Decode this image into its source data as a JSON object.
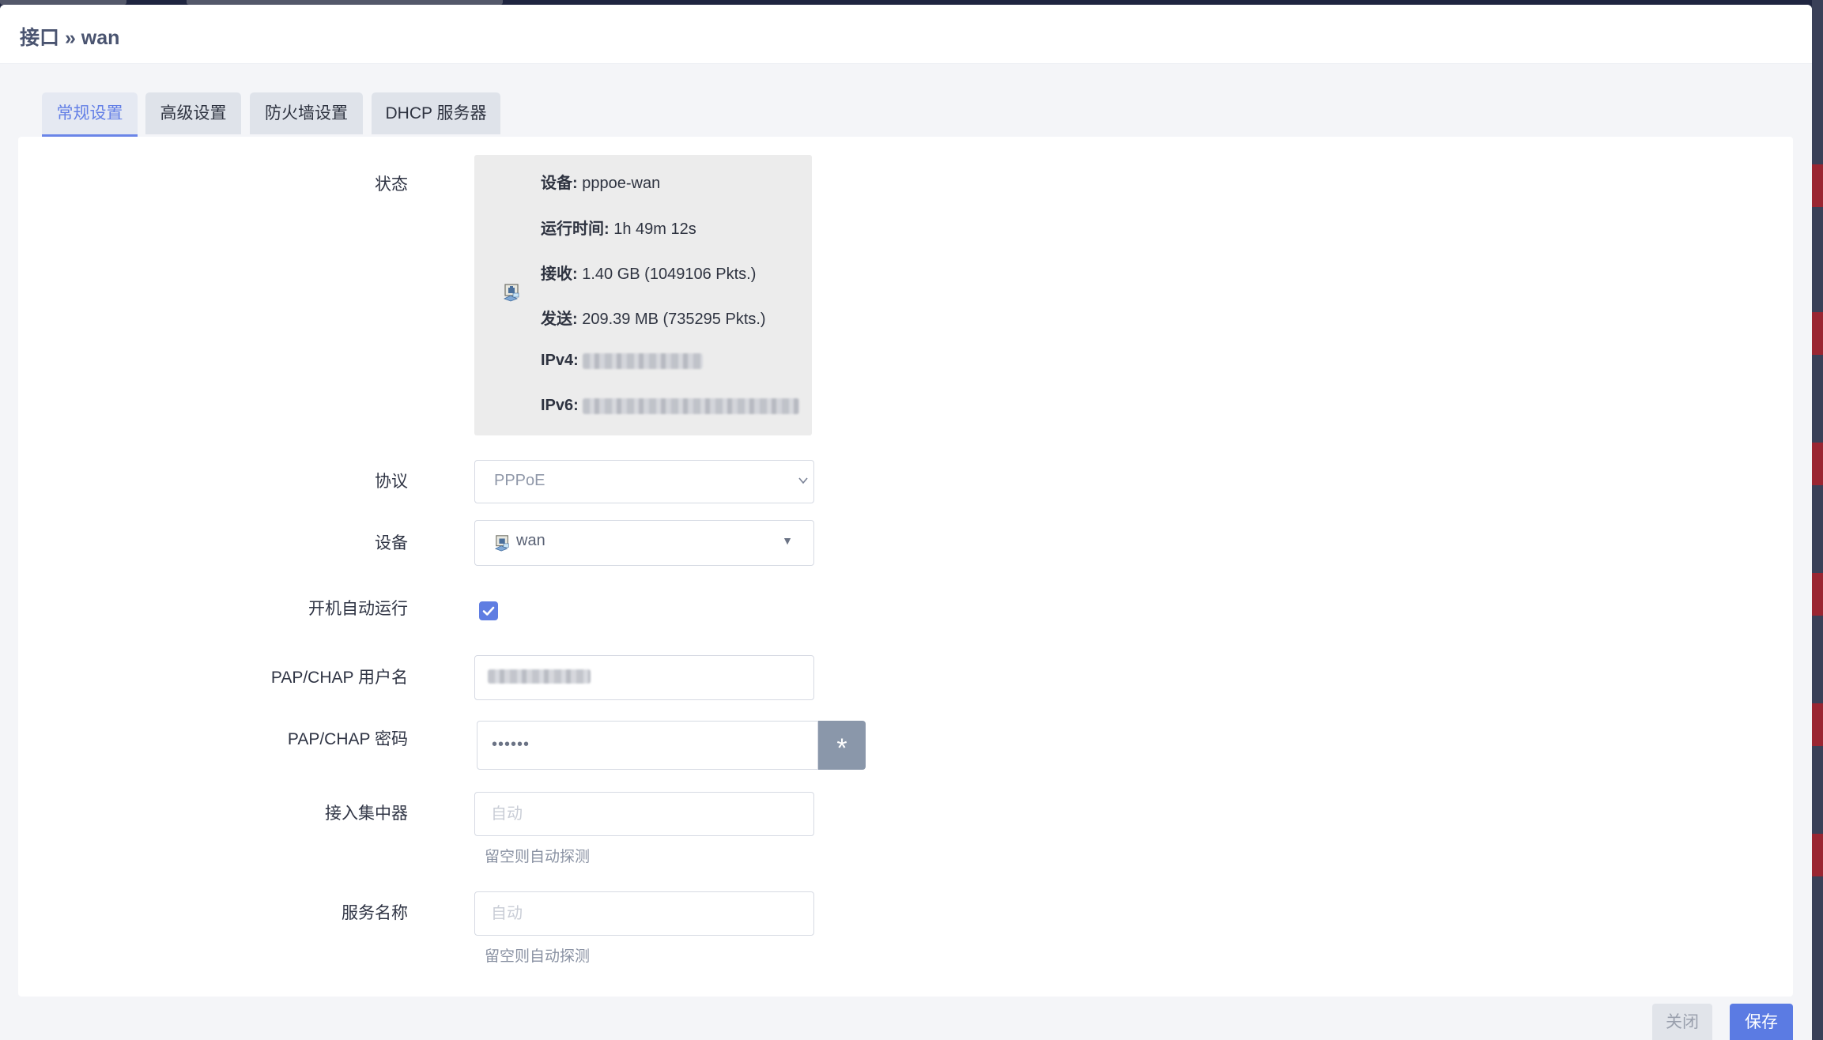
{
  "header": {
    "title": "接口 » wan"
  },
  "tabs": [
    {
      "label": "常规设置",
      "active": true
    },
    {
      "label": "高级设置",
      "active": false
    },
    {
      "label": "防火墙设置",
      "active": false
    },
    {
      "label": "DHCP 服务器",
      "active": false
    }
  ],
  "form": {
    "status": {
      "label": "状态",
      "icon": "ethernet-port-icon",
      "device_key": "设备:",
      "device_value": "pppoe-wan",
      "uptime_key": "运行时间:",
      "uptime_value": "1h 49m 12s",
      "rx_key": "接收:",
      "rx_value": "1.40 GB (1049106 Pkts.)",
      "tx_key": "发送:",
      "tx_value": "209.39 MB (735295 Pkts.)",
      "ipv4_key": "IPv4:",
      "ipv6_key": "IPv6:"
    },
    "protocol": {
      "label": "协议",
      "value": "PPPoE"
    },
    "device": {
      "label": "设备",
      "value": "wan"
    },
    "autostart": {
      "label": "开机自动运行",
      "checked": true
    },
    "username": {
      "label": "PAP/CHAP 用户名"
    },
    "password": {
      "label": "PAP/CHAP 密码",
      "value": "••••••",
      "reveal_label": "*"
    },
    "ac": {
      "label": "接入集中器",
      "placeholder": "自动",
      "hint": "留空则自动探测"
    },
    "service": {
      "label": "服务名称",
      "placeholder": "自动",
      "hint": "留空则自动探测"
    }
  },
  "footer": {
    "close_label": "关闭",
    "save_label": "保存"
  },
  "colors": {
    "accent": "#5b7be3",
    "active_tab_text": "#6480e6",
    "checkbox": "#5f7de2"
  }
}
